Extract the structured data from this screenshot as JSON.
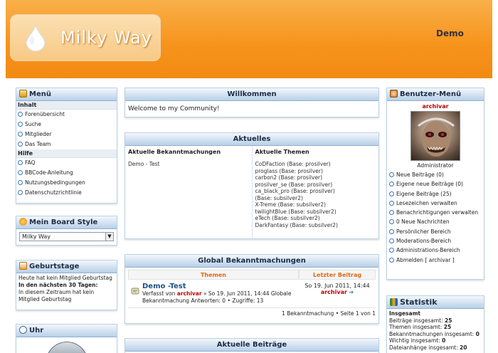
{
  "header": {
    "logo_text": "Milky Way",
    "user_link": "Demo"
  },
  "left_menu": {
    "title": "Menü",
    "groups": [
      {
        "label": "Inhalt",
        "items": [
          "Forenübersicht",
          "Suche",
          "Mitglieder",
          "Das Team"
        ]
      },
      {
        "label": "Hilfe",
        "items": [
          "FAQ",
          "BBCode-Anleitung",
          "Nutzungsbedingungen",
          "Datenschutzrichtlinie"
        ]
      }
    ]
  },
  "board_style": {
    "title": "Mein Board Style",
    "selected": "Milky Way"
  },
  "birthdays": {
    "title": "Geburtstage",
    "today": "Heute hat kein Mitglied Geburtstag",
    "next_heading": "In den nächsten 30 Tagen:",
    "next_text": "In diesem Zeitraum hat kein Mitglied Geburtstag"
  },
  "clock": {
    "title": "Uhr"
  },
  "welcome": {
    "title": "Willkommen",
    "text": "Welcome to my Community!"
  },
  "aktuelles": {
    "title": "Aktuelles",
    "announcements_head": "Aktuelle Bekanntmachungen",
    "announcements": [
      "Demo - Test"
    ],
    "themes_head": "Aktuelle Themen",
    "themes": [
      "CoDFaction (Base: prosilver)",
      "proglass (Base: prosilver)",
      "carbon2 (Base: prosilver)",
      "prosilver_se (Base: prosilver)",
      "ca_black_pro (Base: prosilver)",
      "(Base: subsilver2)",
      "X-Treme (Base: subsilver2)",
      "twilightBlue (Base: subsilver2)",
      "eTech (Base: subsilver2)",
      "DarkFantasy (Base: subsilver2)"
    ]
  },
  "global": {
    "title": "Global Bekanntmachungen",
    "col_topics": "Themen",
    "col_last": "Letzter Beitrag",
    "topic_title": "Demo -Test",
    "topic_meta_prefix": "Verfasst von",
    "topic_author": "archivar",
    "topic_meta_suffix": "» So 19. Jun 2011, 14:44 Globale Bekanntmachung Antworten: 0 • Zugriffe: 13",
    "last_date": "So 19. Jun 2011, 14:44",
    "last_author": "archivar",
    "footer": "1 Bekanntmachung • Seite 1 von 1"
  },
  "recent": {
    "title": "Aktuelle Beiträge"
  },
  "user_menu": {
    "title": "Benutzer-Menü",
    "username": "archivar",
    "rank": "Administrator",
    "items": [
      "Neue Beiträge (0)",
      "Eigene neue Beiträge (0)",
      "Eigene Beiträge (25)",
      "Lesezeichen verwalten",
      "Benachrichtigungen verwalten",
      "0 Neue Nachrichten",
      "Persönlicher Bereich",
      "Moderations-Bereich",
      "Administrations-Bereich",
      "Abmelden [ archivar ]"
    ]
  },
  "statistik": {
    "title": "Statistik",
    "heading": "Insgesamt",
    "lines": [
      {
        "label": "Beiträge insgesamt:",
        "value": "25"
      },
      {
        "label": "Themen insgesamt:",
        "value": "25"
      },
      {
        "label": "Bekanntmachungen insgesamt:",
        "value": "0"
      },
      {
        "label": "Wichtig insgesamt:",
        "value": "0"
      },
      {
        "label": "Dateianhänge insgesamt:",
        "value": "20"
      }
    ]
  },
  "colors": {
    "header_orange": "#f7941d",
    "box_header_blue": "#b9d0e8",
    "accent_red": "#e06a10",
    "link_blue": "#1c4f86"
  }
}
